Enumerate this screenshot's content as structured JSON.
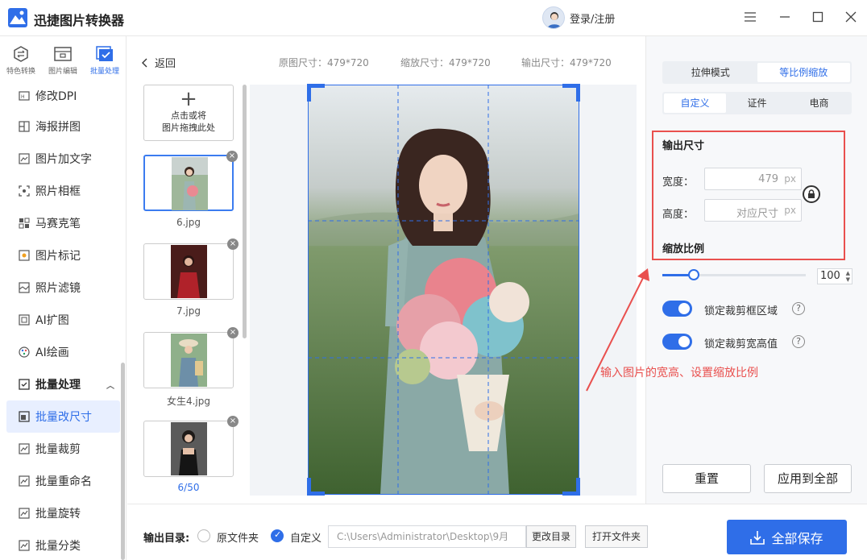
{
  "app": {
    "title": "迅捷图片转换器",
    "login": "登录/注册"
  },
  "top_tabs": [
    {
      "label": "特色转换",
      "icon": "convert-icon"
    },
    {
      "label": "图片编辑",
      "icon": "image-edit-icon"
    },
    {
      "label": "批量处理",
      "icon": "batch-icon"
    }
  ],
  "nav": {
    "items": [
      "修改DPI",
      "海报拼图",
      "图片加文字",
      "照片相框",
      "马赛克笔",
      "图片标记",
      "照片滤镜",
      "AI扩图",
      "AI绘画"
    ],
    "group": "批量处理",
    "batch_items": [
      "批量改尺寸",
      "批量裁剪",
      "批量重命名",
      "批量旋转",
      "批量分类"
    ]
  },
  "toolbar": {
    "back": "返回",
    "original_size": "原图尺寸：479*720",
    "scaled_size": "缩放尺寸：479*720",
    "output_size": "输出尺寸：479*720"
  },
  "thumbs": {
    "add_line1": "点击或将",
    "add_line2": "图片拖拽此处",
    "files": [
      "6.jpg",
      "7.jpg",
      "女生4.jpg"
    ],
    "count": "6/50"
  },
  "right": {
    "mode_tabs": [
      "拉伸模式",
      "等比例缩放"
    ],
    "preset_tabs": [
      "自定义",
      "证件",
      "电商"
    ],
    "output_title": "输出尺寸",
    "width_label": "宽度：",
    "width_value": "479",
    "height_label": "高度：",
    "height_placeholder": "对应尺寸",
    "unit": "px",
    "scale_title": "缩放比例",
    "scale_value": "100",
    "scale_fraction": 0.22,
    "toggle1": "锁定裁剪框区域",
    "toggle2": "锁定裁剪宽高值",
    "annotation": "输入图片的宽高、设置缩放比例",
    "reset": "重置",
    "apply_all": "应用到全部"
  },
  "bottom": {
    "output_dir_label": "输出目录:",
    "opt_original": "原文件夹",
    "opt_custom": "自定义",
    "path": "C:\\Users\\Administrator\\Desktop\\9月",
    "change_dir": "更改目录",
    "open_folder": "打开文件夹",
    "save_all": "全部保存"
  },
  "colors": {
    "accent": "#2f6ee8",
    "annotation": "#e9504e"
  }
}
